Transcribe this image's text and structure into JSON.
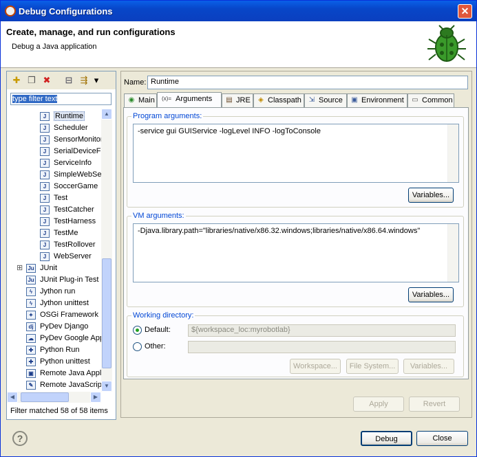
{
  "window": {
    "title": "Debug Configurations",
    "close_glyph": "✕"
  },
  "header": {
    "title": "Create, manage, and run configurations",
    "subtitle": "Debug a Java application"
  },
  "left": {
    "toolbar": [
      {
        "name": "new-config-icon",
        "glyph": "✚"
      },
      {
        "name": "duplicate-icon",
        "glyph": "❐"
      },
      {
        "name": "delete-icon",
        "glyph": "✖"
      },
      {
        "name": "collapse-all-icon",
        "glyph": "⊟"
      },
      {
        "name": "filter-icon",
        "glyph": "⇶"
      },
      {
        "name": "view-menu-icon",
        "glyph": "▾"
      }
    ],
    "filter_value": "type filter text",
    "tree_items": [
      {
        "label": "Runtime",
        "type": "java",
        "sel": true
      },
      {
        "label": "Scheduler",
        "type": "java"
      },
      {
        "label": "SensorMonitor",
        "type": "java"
      },
      {
        "label": "SerialDeviceFa",
        "type": "java"
      },
      {
        "label": "ServiceInfo",
        "type": "java"
      },
      {
        "label": "SimpleWebSer",
        "type": "java"
      },
      {
        "label": "SoccerGame",
        "type": "java"
      },
      {
        "label": "Test",
        "type": "java"
      },
      {
        "label": "TestCatcher",
        "type": "java"
      },
      {
        "label": "TestHarness",
        "type": "java"
      },
      {
        "label": "TestMe",
        "type": "java"
      },
      {
        "label": "TestRollover",
        "type": "java"
      },
      {
        "label": "WebServer",
        "type": "java"
      },
      {
        "label": "JUnit",
        "type": "junit",
        "top": true
      },
      {
        "label": "JUnit Plug-in Test",
        "type": "junitp",
        "top": true
      },
      {
        "label": "Jython run",
        "type": "jython",
        "top": true
      },
      {
        "label": "Jython unittest",
        "type": "jython",
        "top": true
      },
      {
        "label": "OSGi Framework",
        "type": "osgi",
        "top": true
      },
      {
        "label": "PyDev Django",
        "type": "dj",
        "top": true
      },
      {
        "label": "PyDev Google App",
        "type": "gapp",
        "top": true
      },
      {
        "label": "Python Run",
        "type": "py",
        "top": true
      },
      {
        "label": "Python unittest",
        "type": "py",
        "top": true
      },
      {
        "label": "Remote Java Appl",
        "type": "remote",
        "top": true
      },
      {
        "label": "Remote JavaScrip",
        "type": "remotejs",
        "top": true
      }
    ],
    "filter_message": "Filter matched 58 of 58 items"
  },
  "right": {
    "name_label": "Name:",
    "name_value": "Runtime",
    "tabs": [
      {
        "label": "Main",
        "glyph": "◉"
      },
      {
        "label": "Arguments",
        "glyph": "(x)="
      },
      {
        "label": "JRE",
        "glyph": "▤"
      },
      {
        "label": "Classpath",
        "glyph": "◈"
      },
      {
        "label": "Source",
        "glyph": "⇲"
      },
      {
        "label": "Environment",
        "glyph": "▣"
      },
      {
        "label": "Common",
        "glyph": "▭"
      }
    ],
    "program_args_label": "Program arguments:",
    "program_args_value": "-service gui GUIService -logLevel INFO -logToConsole",
    "vm_args_label": "VM arguments:",
    "vm_args_value": "-Djava.library.path=\"libraries/native/x86.32.windows;libraries/native/x86.64.windows\"",
    "variables_label": "Variables...",
    "working_dir_label": "Working directory:",
    "default_label": "Default:",
    "default_value": "${workspace_loc:myrobotlab}",
    "other_label": "Other:",
    "workspace_label": "Workspace...",
    "filesystem_label": "File System...",
    "apply_label": "Apply",
    "revert_label": "Revert"
  },
  "footer": {
    "help_glyph": "?",
    "debug_label": "Debug",
    "close_label": "Close"
  }
}
